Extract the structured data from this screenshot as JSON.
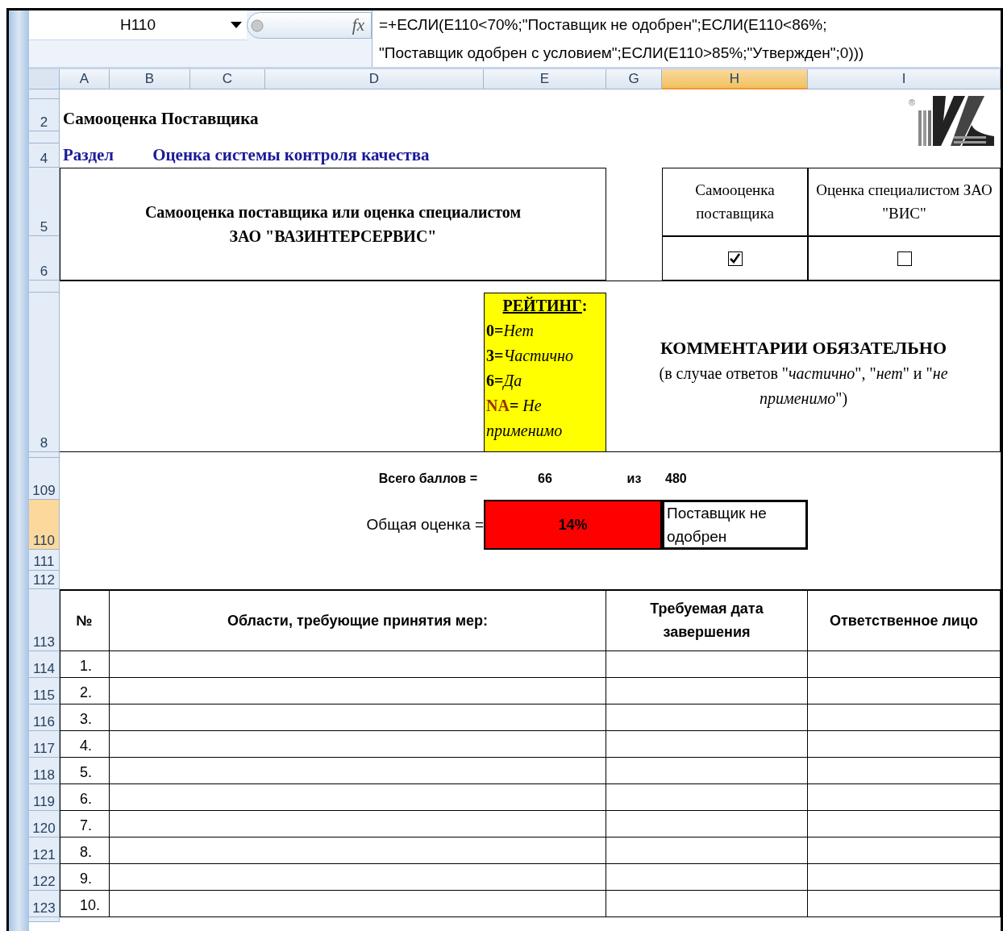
{
  "formula_bar": {
    "name_box": "H110",
    "fx_label": "fx",
    "formula_lines": [
      "=+ЕСЛИ(E110<70%;\"Поставщик не одобрен\";ЕСЛИ(E110<86%;",
      "\"Поставщик одобрен с условием\";ЕСЛИ(E110>85%;\"Утвержден\";0)))"
    ]
  },
  "columns": [
    {
      "label": "A",
      "selected": false
    },
    {
      "label": "B",
      "selected": false
    },
    {
      "label": "C",
      "selected": false
    },
    {
      "label": "D",
      "selected": false
    },
    {
      "label": "E",
      "selected": false
    },
    {
      "label": "G",
      "selected": false
    },
    {
      "label": "H",
      "selected": true
    },
    {
      "label": "I",
      "selected": false
    }
  ],
  "row_headers": [
    {
      "label": "2",
      "selected": false
    },
    {
      "label": "4",
      "selected": false
    },
    {
      "label": "5",
      "selected": false
    },
    {
      "label": "6",
      "selected": false
    },
    {
      "label": "8",
      "selected": false
    },
    {
      "label": "109",
      "selected": false
    },
    {
      "label": "110",
      "selected": true
    },
    {
      "label": "111",
      "selected": false
    },
    {
      "label": "112",
      "selected": false
    },
    {
      "label": "113",
      "selected": false
    },
    {
      "label": "114",
      "selected": false
    },
    {
      "label": "115",
      "selected": false
    },
    {
      "label": "116",
      "selected": false
    },
    {
      "label": "117",
      "selected": false
    },
    {
      "label": "118",
      "selected": false
    },
    {
      "label": "119",
      "selected": false
    },
    {
      "label": "120",
      "selected": false
    },
    {
      "label": "121",
      "selected": false
    },
    {
      "label": "122",
      "selected": false
    },
    {
      "label": "123",
      "selected": false
    }
  ],
  "sheet": {
    "title": "Самооценка Поставщика",
    "logo_mark": "®",
    "section_label": "Раздел",
    "section_name": "Оценка системы контроля качества",
    "assessor_heading": "Самооценка поставщика или оценка специалистом ЗАО \"ВАЗИНТЕРСЕРВИС\"",
    "assessor_options": [
      {
        "label": "Самооценка поставщика",
        "checked": true
      },
      {
        "label": "Оценка специалистом ЗАО \"ВИС\"",
        "checked": false
      }
    ],
    "rating": {
      "title": "РЕЙТИНГ",
      "title_suffix": ":",
      "items": [
        {
          "code": "0",
          "separator": "=",
          "text": "Нет",
          "color": "#000000"
        },
        {
          "code": "3",
          "separator": "=",
          "text": "Частично",
          "color": "#000000"
        },
        {
          "code": "6",
          "separator": "=",
          "text": "Да",
          "color": "#000000"
        },
        {
          "code": "NA",
          "separator": "=",
          "text": " Не применимо",
          "color": "#993300"
        }
      ]
    },
    "comments_title": "КОММЕНТАРИИ ОБЯЗАТЕЛЬНО",
    "comments_note": "(в случае ответов \"*частично*\", \"*нет*\" и \"*не применимо*\")",
    "totals": {
      "label": "Всего баллов =",
      "score": "66",
      "of": "из",
      "max": "480"
    },
    "overall": {
      "label": "Общая оценка =",
      "value": "14%",
      "color": "#ff0000",
      "verdict": "Поставщик не одобрен"
    },
    "actions": {
      "columns": [
        "№",
        "Области, требующие принятия мер:",
        "Требуемая дата завершения",
        "Ответственное лицо"
      ],
      "rows": [
        "1.",
        "2.",
        "3.",
        "4.",
        "5.",
        "6.",
        "7.",
        "8.",
        "9.",
        "10."
      ]
    }
  }
}
